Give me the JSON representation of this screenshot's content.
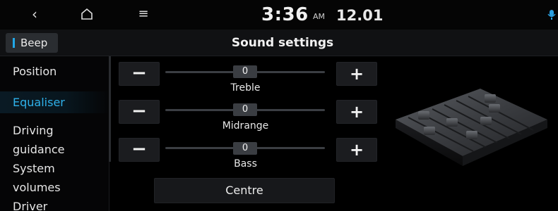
{
  "status_bar": {
    "back_icon": "back-chevron-icon",
    "home_icon": "home-icon",
    "menu_icon": "menu-icon",
    "time": "3:36",
    "ampm": "AM",
    "date": "12.01",
    "mic_icon": "voice-recognition-icon"
  },
  "header": {
    "back_tab_label": "Beep",
    "title": "Sound settings",
    "accent_color": "#22a8e8"
  },
  "sidebar": {
    "items": [
      {
        "label": "Position",
        "active": false
      },
      {
        "label": "Equaliser",
        "active": true
      },
      {
        "label": "Driving",
        "label2": "guidance",
        "active": false
      },
      {
        "label": "System",
        "label2": "volumes",
        "active": false
      },
      {
        "label": "Driver",
        "active": false
      }
    ]
  },
  "equaliser": {
    "rows": [
      {
        "name": "Treble",
        "value": "0"
      },
      {
        "name": "Midrange",
        "value": "0"
      },
      {
        "name": "Bass",
        "value": "0"
      }
    ],
    "minus_label": "−",
    "plus_label": "+",
    "centre_label": "Centre"
  },
  "illustration": {
    "icon": "equaliser-mixer-illustration"
  }
}
